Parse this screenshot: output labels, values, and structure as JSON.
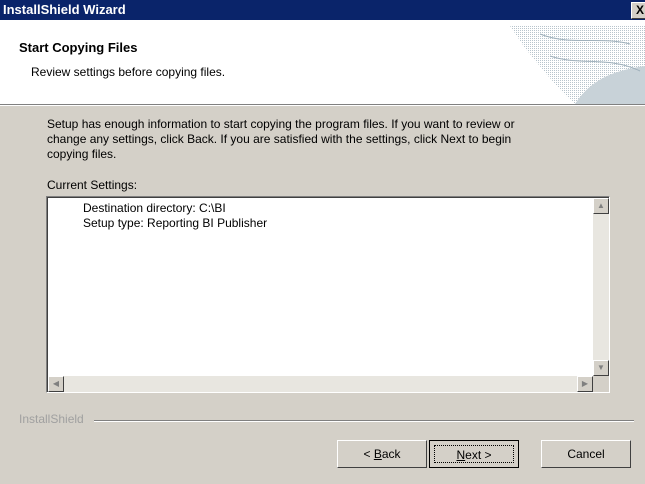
{
  "window": {
    "title": "InstallShield Wizard",
    "close_glyph": "X"
  },
  "header": {
    "title": "Start Copying Files",
    "subtitle": "Review settings before copying files."
  },
  "body": {
    "description_lines": [
      "Setup has enough information to start copying the program files.  If you want to review or",
      "change any settings, click Back.  If you are satisfied with the settings, click Next to begin",
      "copying files."
    ],
    "current_settings_label": "Current Settings:",
    "settings_lines": [
      "Destination directory:  C:\\BI",
      "Setup type:  Reporting BI Publisher"
    ]
  },
  "footer": {
    "brand": "InstallShield"
  },
  "buttons": {
    "back": {
      "prefix": "< ",
      "hotkey": "B",
      "rest": "ack"
    },
    "next": {
      "hotkey": "N",
      "rest": "ext >"
    },
    "cancel": "Cancel"
  },
  "icons": {
    "close": "close-icon",
    "scroll_up": "scroll-up-arrow-icon",
    "scroll_down": "scroll-down-arrow-icon",
    "scroll_left": "scroll-left-arrow-icon",
    "scroll_right": "scroll-right-arrow-icon",
    "header_art": "installshield-header-graphic"
  }
}
